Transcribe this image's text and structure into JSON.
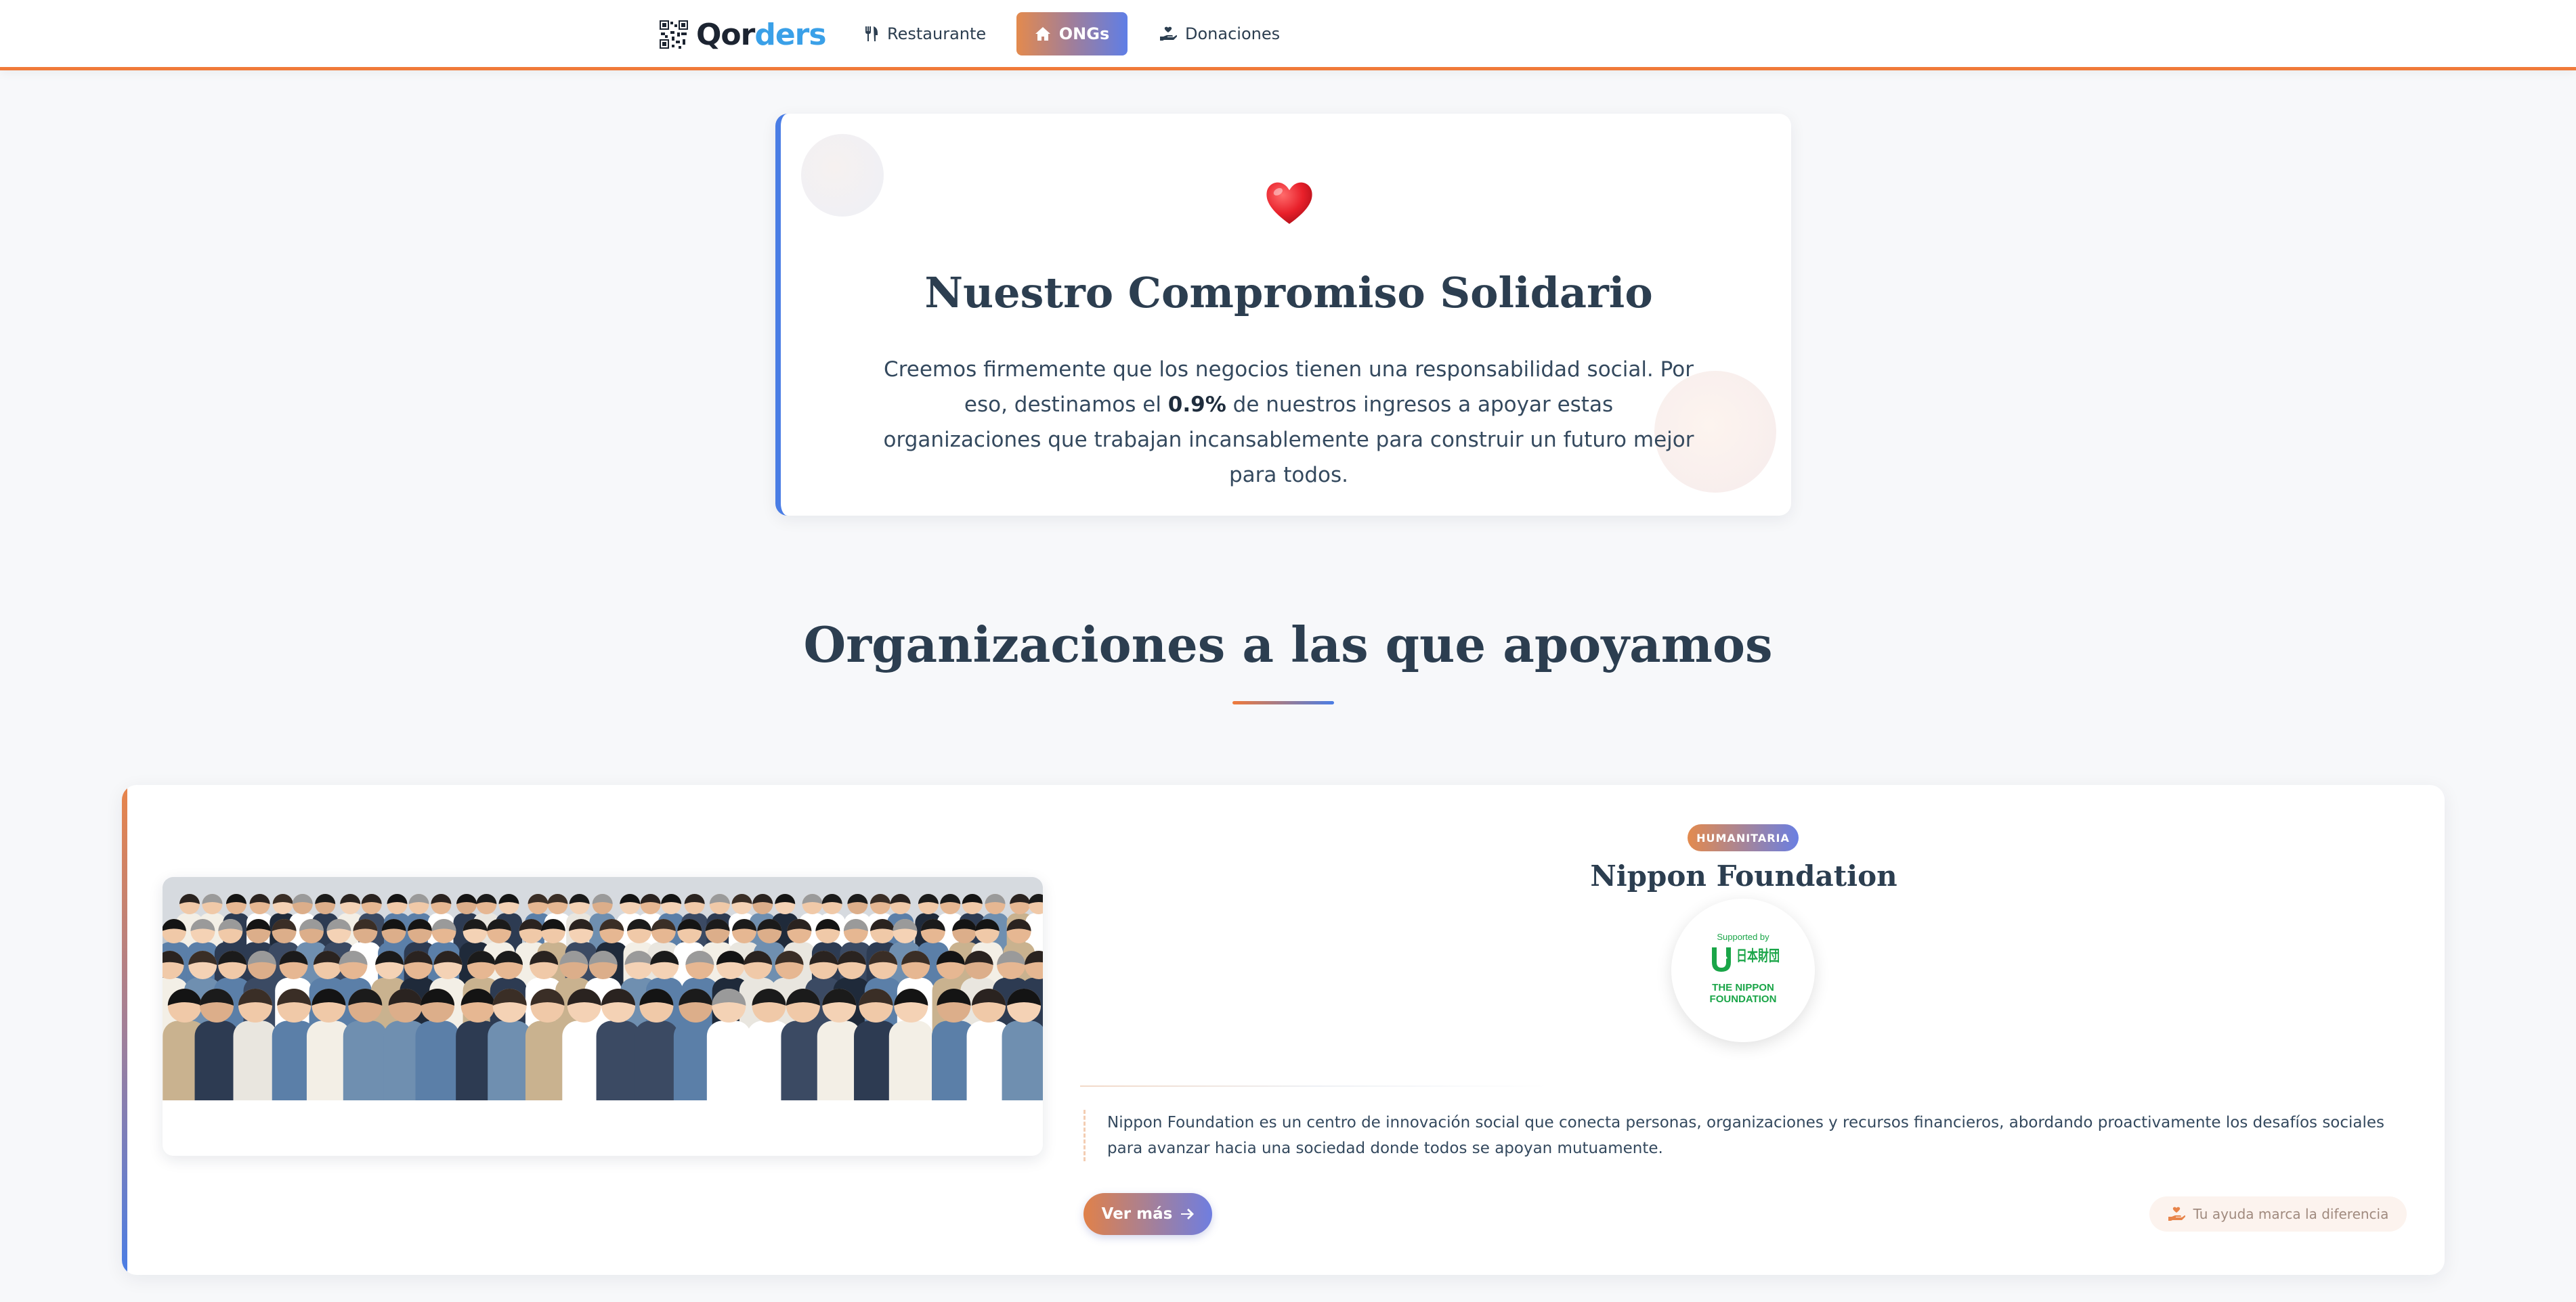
{
  "navbar": {
    "brand": {
      "part1": "Qor",
      "part2": "ders"
    },
    "items": [
      {
        "label": "Restaurante",
        "icon": "utensils-icon"
      },
      {
        "label": "ONGs",
        "icon": "home-icon",
        "active": true
      },
      {
        "label": "Donaciones",
        "icon": "hand-holding-heart-icon"
      }
    ]
  },
  "commitment": {
    "icon": "heart-icon",
    "title": "Nuestro Compromiso Solidario",
    "text_before": "Creemos firmemente que los negocios tienen una responsabilidad social. Por eso, destinamos el ",
    "highlight": "0.9%",
    "text_after": " de nuestros ingresos a apoyar estas organizaciones que trabajan incansablemente para construir un futuro mejor para todos."
  },
  "section": {
    "title": "Organizaciones a las que apoyamos"
  },
  "organizations": [
    {
      "category": "HUMANITARIA",
      "name": "Nippon Foundation",
      "logo": {
        "supported_by": "Supported by",
        "kanji": "日本財団",
        "line1": "THE NIPPON",
        "line2": "FOUNDATION"
      },
      "description": "Nippon Foundation es un centro de innovación social que conecta personas, organizaciones y recursos financieros, abordando proactivamente los desafíos sociales para avanzar hacia una sociedad donde todos se apoyan mutuamente.",
      "cta_label": "Ver más",
      "help_label": "Tu ayuda marca la diferencia"
    }
  ],
  "colors": {
    "accent_orange": "#f07a3a",
    "accent_blue": "#4a7de5",
    "text_dark": "#2c3e50",
    "nippon_green": "#1aa548"
  }
}
